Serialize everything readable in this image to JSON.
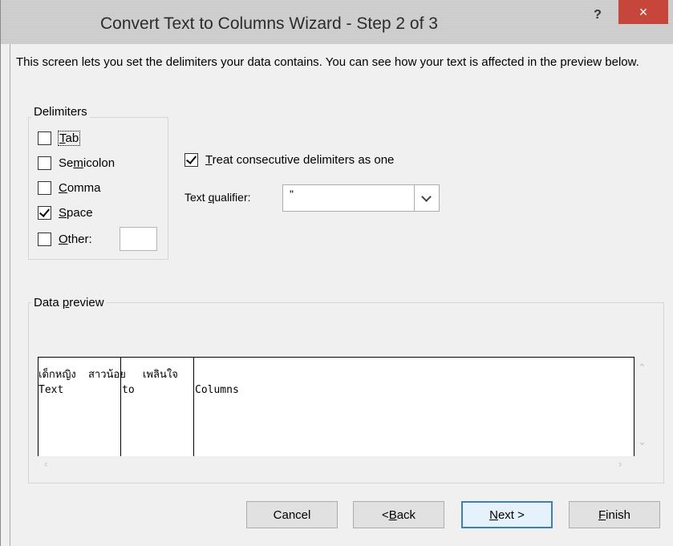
{
  "window": {
    "title": "Convert Text to Columns Wizard - Step 2 of 3",
    "help_label": "?",
    "close_label": "×"
  },
  "description": "This screen lets you set the delimiters your data contains.  You can see how your text is affected in the preview below.",
  "delimiters": {
    "group_label": "Delimiters",
    "items": [
      {
        "prefix": "",
        "accel": "T",
        "suffix": "ab",
        "checked": false
      },
      {
        "prefix": "Se",
        "accel": "m",
        "suffix": "icolon",
        "checked": false
      },
      {
        "prefix": "",
        "accel": "C",
        "suffix": "omma",
        "checked": false
      },
      {
        "prefix": "",
        "accel": "S",
        "suffix": "pace",
        "checked": true
      },
      {
        "prefix": "",
        "accel": "O",
        "suffix": "ther:",
        "checked": false
      }
    ],
    "other_value": ""
  },
  "options": {
    "consecutive": {
      "prefix": "",
      "accel": "T",
      "suffix": "reat consecutive delimiters as one",
      "checked": true
    },
    "qualifier": {
      "label_prefix": "Text ",
      "label_accel": "q",
      "label_suffix": "ualifier:",
      "value": "\""
    }
  },
  "preview": {
    "group_label_prefix": "Data ",
    "group_label_accel": "p",
    "group_label_suffix": "review",
    "rows": [
      [
        "เด็กหญิง",
        "สาวน้อย",
        "เพลินใจ"
      ],
      [
        "Text",
        "to",
        "Columns"
      ]
    ]
  },
  "buttons": {
    "cancel": {
      "label": "Cancel"
    },
    "back": {
      "prefix": "< ",
      "accel": "B",
      "suffix": "ack"
    },
    "next": {
      "prefix": "",
      "accel": "N",
      "suffix": "ext >"
    },
    "finish": {
      "prefix": "",
      "accel": "F",
      "suffix": "inish"
    }
  }
}
